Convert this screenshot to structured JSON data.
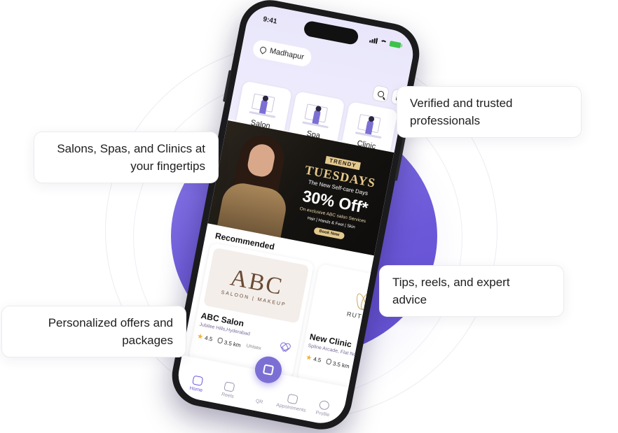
{
  "callouts": {
    "verified": "Verified and trusted\nprofessionals",
    "salons": "Salons, Spas, and Clinics at\nyour fingertips",
    "tips": "Tips, reels, and expert\nadvice",
    "offers": "Personalized offers and\npackages"
  },
  "status_bar": {
    "time": "9:41"
  },
  "header": {
    "location": "Madhapur"
  },
  "categories": [
    {
      "label": "Salon"
    },
    {
      "label": "Spa"
    },
    {
      "label": "Clinic"
    }
  ],
  "banner": {
    "tag": "TRENDY",
    "title": "TUESDAYS",
    "subtitle": "The New Self-care Days",
    "offer": "30% Off*",
    "note": "On exclusive ABC salon Services",
    "services": "Hair | Hands & Feet | Skin",
    "cta": "Book Now"
  },
  "recommended": {
    "title": "Recommended",
    "items": [
      {
        "logo": "ABC",
        "logo_sub": "SALOON | MAKEUP",
        "name": "ABC Salon",
        "address": "Jubilee Hills,Hyderabad",
        "rating": "4.5",
        "distance": "3.5 km",
        "type": "Unisex"
      },
      {
        "logo": "RUTHVIK",
        "name": "New Clinic",
        "address": "Spline Arcade, Flat No",
        "rating": "4.5",
        "distance": "3.5 km"
      }
    ]
  },
  "tabbar": {
    "tabs": [
      {
        "label": "Home",
        "icon": "home-icon"
      },
      {
        "label": "Reels",
        "icon": "reels-icon"
      },
      {
        "label": "QR",
        "icon": "qr-icon"
      },
      {
        "label": "Appointments",
        "icon": "calendar-icon"
      },
      {
        "label": "Profile",
        "icon": "profile-icon"
      }
    ]
  },
  "colors": {
    "accent": "#6b58d8",
    "disc": "#7765e0",
    "gold": "#e3c98f",
    "star": "#f2b233"
  }
}
